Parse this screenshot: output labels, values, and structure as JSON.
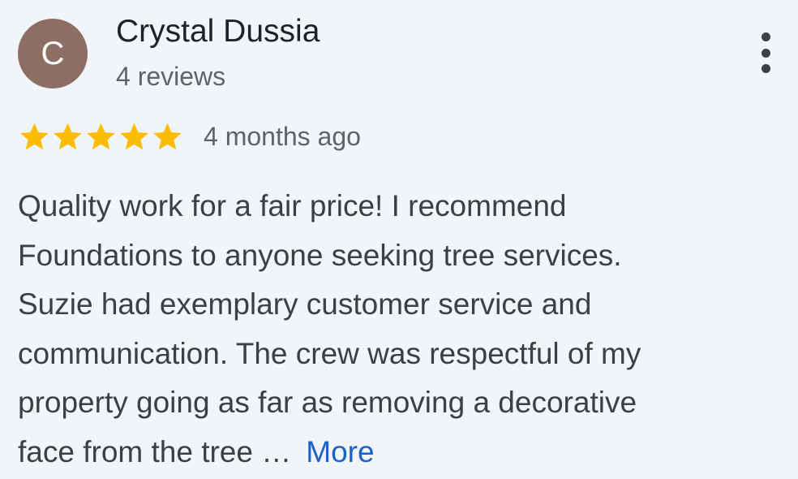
{
  "reviewer": {
    "initial": "C",
    "name": "Crystal Dussia",
    "reviews_count": "4 reviews",
    "avatar_color": "#8d6e63"
  },
  "menu": {
    "icon": "more-vertical-icon"
  },
  "rating": {
    "stars": 5,
    "max_stars": 5,
    "star_color": "#fbbc04",
    "date": "4 months ago"
  },
  "review": {
    "lines": [
      "Quality work for a fair price! I recommend",
      "Foundations to anyone seeking tree services.",
      "Suzie had exemplary customer service and",
      "communication. The crew was respectful of my",
      "property going as far as removing a decorative",
      "face from the tree …"
    ],
    "more_label": "More",
    "link_color": "#1a62c9"
  }
}
